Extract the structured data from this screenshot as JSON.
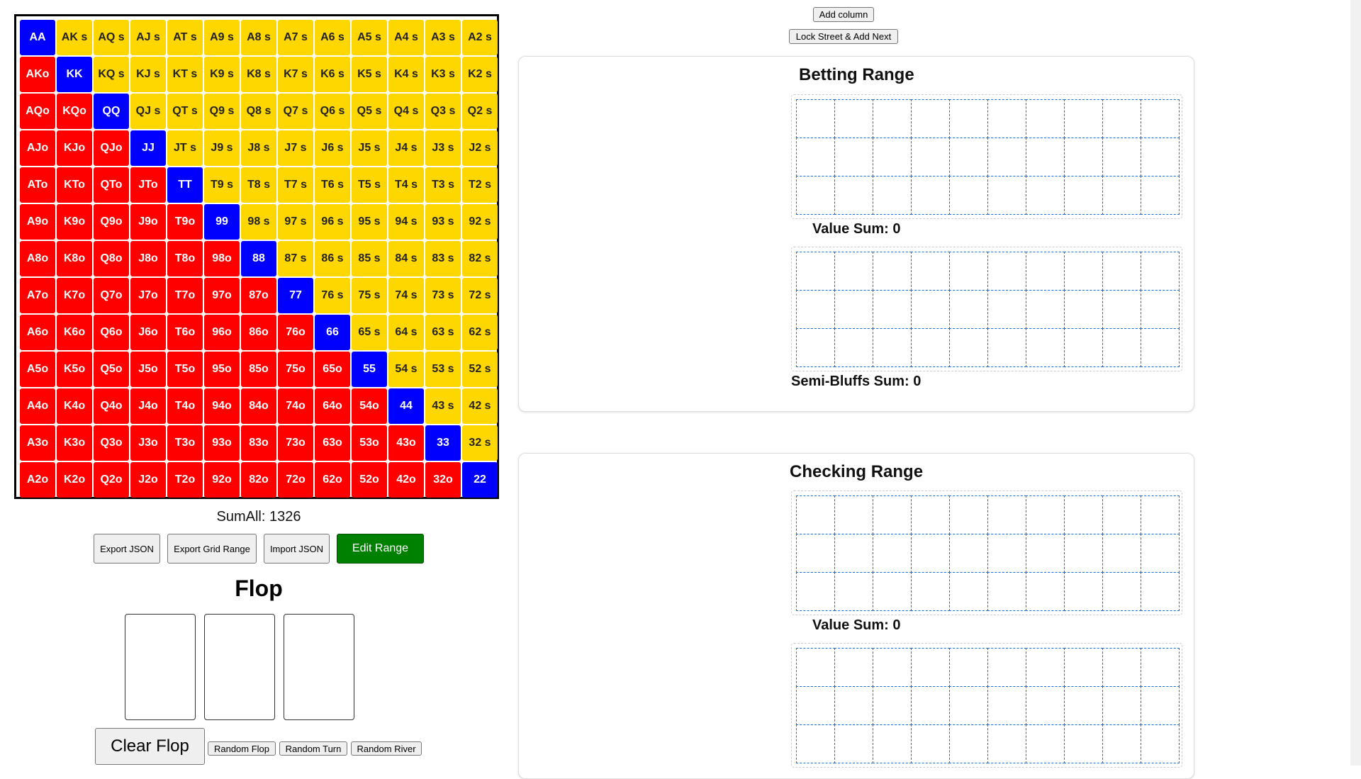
{
  "hand_grid": {
    "ranks": [
      "A",
      "K",
      "Q",
      "J",
      "T",
      "9",
      "8",
      "7",
      "6",
      "5",
      "4",
      "3",
      "2"
    ],
    "colors": {
      "pair": "#0000ff",
      "suited": "#ffd700",
      "offsuit": "#ff0000"
    }
  },
  "sum_all": "SumAll: 1326",
  "buttons": {
    "export_json": "Export JSON",
    "export_grid_range": "Export Grid Range",
    "import_json": "Import JSON",
    "edit_range": "Edit Range",
    "add_column": "Add column",
    "lock_street": "Lock Street & Add Next",
    "clear_flop": "Clear Flop",
    "random_flop": "Random Flop",
    "random_turn": "Random Turn",
    "random_river": "Random River"
  },
  "flop_title": "Flop",
  "panels": {
    "betting": {
      "title": "Betting Range",
      "value_sum": "Value Sum: 0",
      "semi_bluffs_sum": "Semi-Bluffs Sum: 0"
    },
    "checking": {
      "title": "Checking Range",
      "value_sum": "Value Sum: 0"
    }
  }
}
